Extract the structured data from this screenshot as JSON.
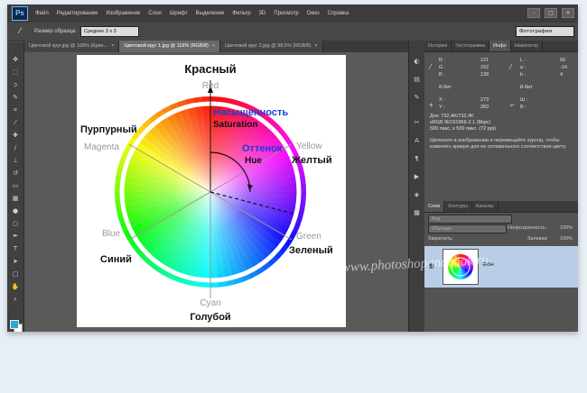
{
  "menu": {
    "logo": "Ps",
    "items": [
      "Файл",
      "Редактирование",
      "Изображение",
      "Слои",
      "Шрифт",
      "Выделение",
      "Фильтр",
      "3D",
      "Просмотр",
      "Окно",
      "Справка"
    ]
  },
  "options": {
    "sample_label": "Размер образца:",
    "sample_value": "Среднее 3 x 3",
    "workspace": "Фотография"
  },
  "tabs": [
    {
      "label": "Цветовой круг.jpg @ 108% (Крие...",
      "close": "×",
      "active": false
    },
    {
      "label": "Цветовой круг 1.jpg @ 119% (RGB/8)",
      "close": "×",
      "active": true
    },
    {
      "label": "Цветовой круг 2.jpg @ 98,5% (RGB/8)",
      "close": "×",
      "active": false
    }
  ],
  "canvas": {
    "red_ru": "Красный",
    "red_en": "Red",
    "saturation_ru": "Насыщенность",
    "saturation_en": "Saturation",
    "magenta_ru": "Пурпурный",
    "magenta_en": "Magenta",
    "hue_ru": "Оттенок",
    "hue_en": "Hue",
    "yellow_ru": "Желтый",
    "yellow_en": "Yellow",
    "blue_en": "Blue",
    "blue_ru": "Синий",
    "green_en": "Green",
    "green_ru": "Зеленый",
    "cyan_en": "Cyan",
    "cyan_ru": "Голубой"
  },
  "panels": {
    "info_tabs": [
      "История",
      "Гистограмма",
      "Инфо",
      "Навигатор"
    ],
    "info": {
      "r_label": "R :",
      "r": "121",
      "g_label": "G :",
      "g": "152",
      "b_label": "B :",
      "b": "138",
      "l_label": "L :",
      "l": "60",
      "a_label": "a :",
      "a": "-14",
      "b2_label": "b :",
      "b2": "4",
      "bit_left": "8-бит",
      "bit_right": "8-бит",
      "x_label": "X :",
      "x": "273",
      "y_label": "Y :",
      "y": "283",
      "w_label": "Ш :",
      "h_label": "В :",
      "doc": "Док: 732,4K/732,4K",
      "profile": "sRGB IEC61966-2.1 (8bpc)",
      "size": "500 пикс. x 500 пикс. (72 ppi)",
      "hint": "Щелкните в изображении и перемещайте курсор, чтобы изменить кривую для ее оптимального соответствия цвету."
    },
    "layer_tabs": [
      "Слои",
      "Контуры",
      "Каналы"
    ],
    "layers": {
      "kind": "Вид",
      "blend": "Обычные",
      "opacity_label": "Непрозрачность:",
      "opacity": "100%",
      "lock_label": "Закрепить:",
      "fill_label": "Заливка:",
      "fill": "100%",
      "layer_name": "Фон"
    }
  },
  "watermark": "www.photoshopandchok.ru",
  "colors": {
    "accent": "#1a3fd6",
    "selected_layer": "#b9cde6"
  }
}
